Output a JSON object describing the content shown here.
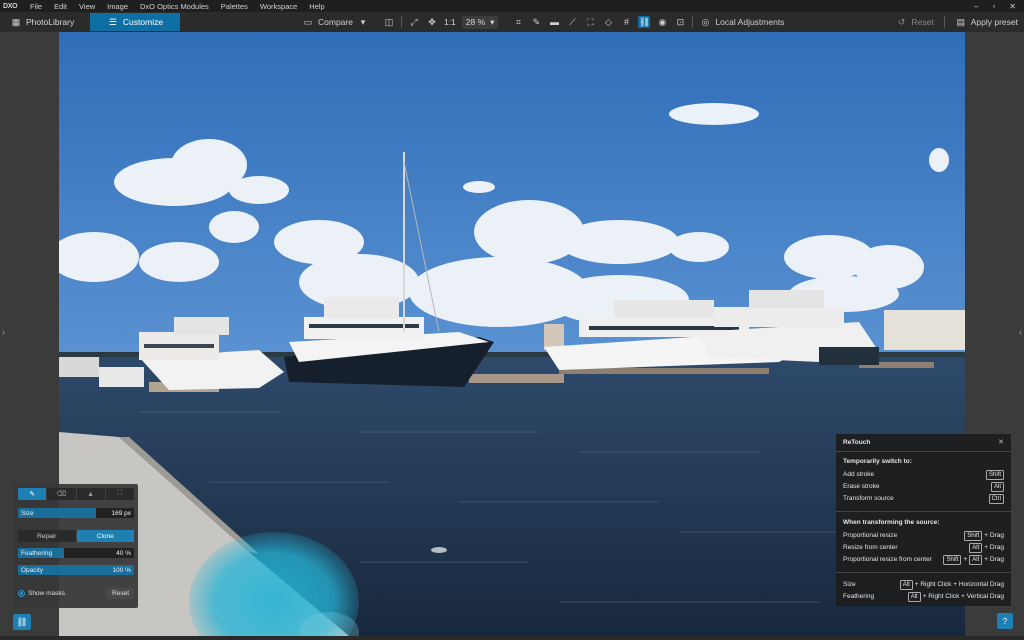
{
  "app": {
    "logo": "DXO"
  },
  "menubar": {
    "items": [
      "File",
      "Edit",
      "View",
      "Image",
      "DxO Optics Modules",
      "Palettes",
      "Workspace",
      "Help"
    ],
    "window_controls": [
      "–",
      "▫",
      "✕"
    ]
  },
  "toolbar": {
    "photolibrary_label": "PhotoLibrary",
    "customize_label": "Customize",
    "compare_label": "Compare",
    "one_to_one_label": "1:1",
    "zoom_value": "28 %",
    "local_adjustments_label": "Local Adjustments",
    "reset_label": "Reset",
    "apply_preset_label": "Apply preset"
  },
  "brush_panel": {
    "size_label": "Size",
    "size_value": "169 px",
    "size_fraction": 0.67,
    "repair_label": "Repair",
    "clone_label": "Clone",
    "feathering_label": "Feathering",
    "feathering_value": "40 %",
    "feathering_fraction": 0.4,
    "opacity_label": "Opacity",
    "opacity_value": "100 %",
    "opacity_fraction": 1.0,
    "show_masks_label": "Show masks",
    "reset_label": "Reset"
  },
  "retouch_help": {
    "title": "ReTouch",
    "close": "✕",
    "section1_title": "Temporarily switch to:",
    "add_stroke": "Add stroke",
    "add_stroke_key": "Shift",
    "erase_stroke": "Erase stroke",
    "erase_stroke_key": "Alt",
    "transform_source": "Transform source",
    "transform_source_key": "Ctrl",
    "section2_title": "When transforming the source:",
    "prop_resize": "Proportional resize",
    "prop_resize_key": "Shift",
    "prop_resize_suffix": "+ Drag",
    "resize_center": "Resize from center",
    "resize_center_key": "Alt",
    "resize_center_suffix": "+ Drag",
    "prop_resize_center": "Proportional resize from center",
    "prop_resize_center_key1": "Shift",
    "plus": "+",
    "prop_resize_center_key2": "Alt",
    "prop_resize_center_suffix": "+ Drag",
    "size_label": "Size",
    "size_key": "Alt",
    "size_suffix": "+ Right Click + Horizontal Drag",
    "feathering_label": "Feathering",
    "feathering_key": "Alt",
    "feathering_suffix": "+ Right Click + Vertical Drag"
  },
  "help_button": "?",
  "colors": {
    "accent": "#1e7fb3",
    "panel": "#373737",
    "sky": "#3f7fc8",
    "water": "#1f3550"
  }
}
